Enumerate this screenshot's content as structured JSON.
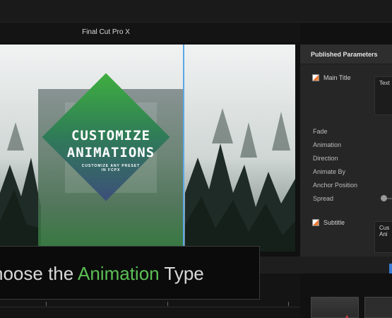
{
  "window": {
    "title": "Final Cut Pro X"
  },
  "viewer": {
    "main_title_line1": "CUSTOMIZE",
    "main_title_line2": "ANIMATIONS",
    "subtitle_line1": "CUSTOMIZE ANY PRESET",
    "subtitle_line2": "IN FCPX"
  },
  "inspector": {
    "header": "Published Parameters",
    "main_title_label": "Main Title",
    "main_title_value": "Text",
    "params": [
      "Fade",
      "Animation",
      "Direction",
      "Animate By",
      "Anchor Position",
      "Spread"
    ],
    "subtitle_label": "Subtitle",
    "subtitle_value_line1": "Cus",
    "subtitle_value_line2": "Ani"
  },
  "caption": {
    "prefix": "hoose the ",
    "accent": "Animation",
    "suffix": " Type"
  },
  "colors": {
    "accent": "#5bbf55",
    "selection": "#5aa7e8",
    "marker": "#3a7bd5"
  }
}
